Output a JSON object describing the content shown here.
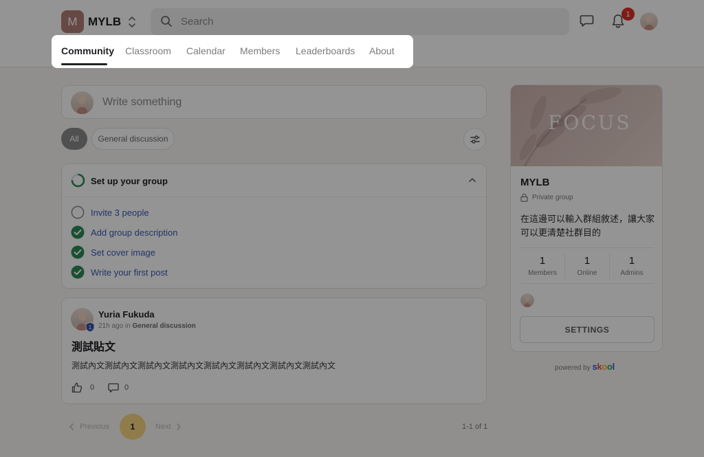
{
  "header": {
    "logo_letter": "M",
    "group_name": "MYLB",
    "search_placeholder": "Search",
    "notification_count": "1"
  },
  "tabs": [
    {
      "label": "Community",
      "active": true
    },
    {
      "label": "Classroom",
      "active": false
    },
    {
      "label": "Calendar",
      "active": false
    },
    {
      "label": "Members",
      "active": false
    },
    {
      "label": "Leaderboards",
      "active": false
    },
    {
      "label": "About",
      "active": false
    }
  ],
  "composer": {
    "placeholder": "Write something"
  },
  "filters": {
    "all": "All",
    "general": "General discussion"
  },
  "setup": {
    "title": "Set up your group",
    "tasks": [
      {
        "label": "Invite 3 people",
        "done": false
      },
      {
        "label": "Add group description",
        "done": true
      },
      {
        "label": "Set cover image",
        "done": true
      },
      {
        "label": "Write your first post",
        "done": true
      }
    ]
  },
  "post": {
    "author": "Yuria Fukuda",
    "level": "1",
    "time": "21h ago in",
    "category": "General discussion",
    "title": "測試貼文",
    "body": "測試內文測試內文測試內文測試內文測試內文測試內文測試內文測試內文",
    "likes": "0",
    "comments": "0"
  },
  "pagination": {
    "previous": "Previous",
    "current": "1",
    "next": "Next",
    "range": "1-1 of 1"
  },
  "sidebar": {
    "cover_text": "FOCUS",
    "group_name": "MYLB",
    "privacy": "Private group",
    "description": "在這邊可以輸入群組敘述，讓大家可以更清楚社群目的",
    "stats": [
      {
        "value": "1",
        "label": "Members"
      },
      {
        "value": "1",
        "label": "Online"
      },
      {
        "value": "1",
        "label": "Admins"
      }
    ],
    "settings_label": "SETTINGS"
  },
  "footer": {
    "powered_by": "powered by",
    "brand": "skool"
  },
  "colors": {
    "accent_green": "#2e8b57",
    "link_blue": "#3a5bb8",
    "badge_red": "#d93025",
    "page_yellow": "#f8d481",
    "logo_mauve": "#b07c78"
  }
}
